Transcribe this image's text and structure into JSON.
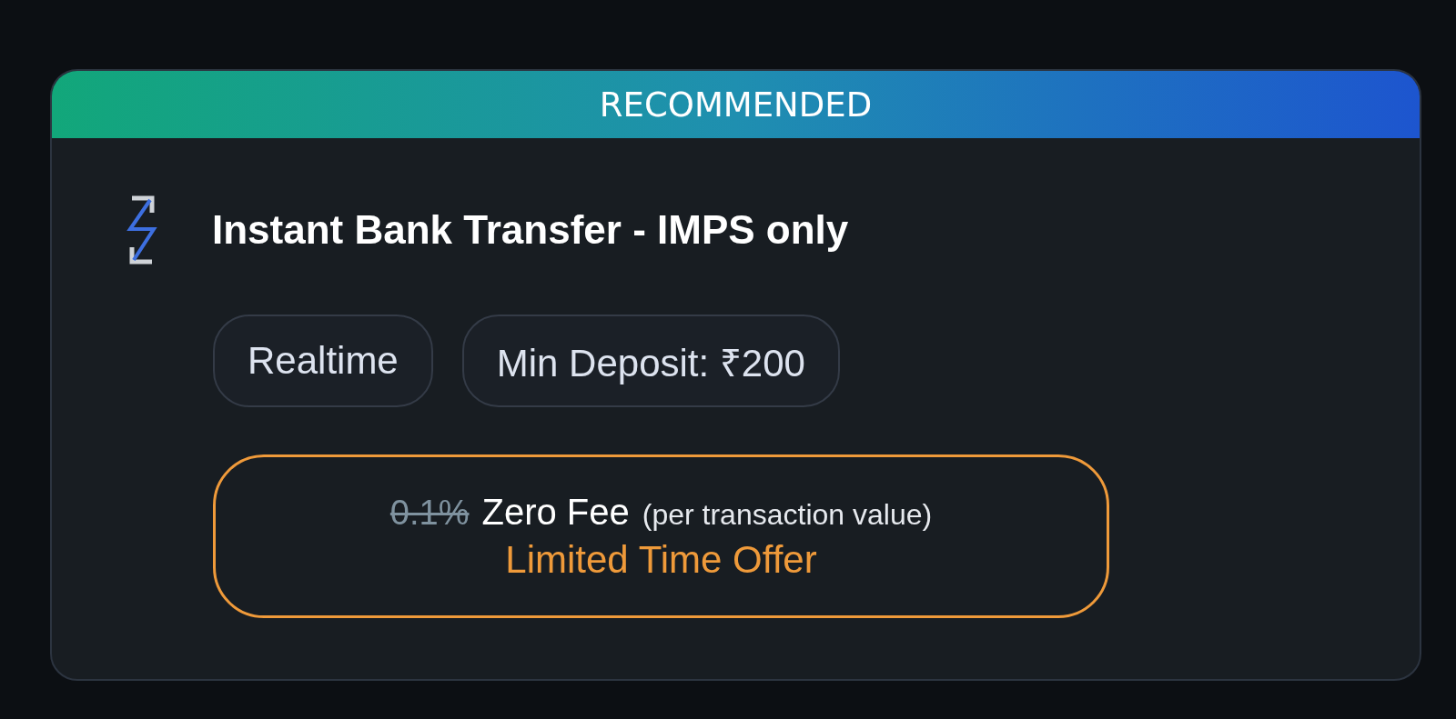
{
  "card": {
    "banner": "RECOMMENDED",
    "title": "Instant Bank Transfer - IMPS only",
    "chips": [
      "Realtime",
      "Min Deposit: ₹200"
    ],
    "offer": {
      "old_price": "0.1%",
      "price": "Zero Fee",
      "note": "(per transaction value)",
      "tagline": "Limited Time Offer"
    }
  }
}
